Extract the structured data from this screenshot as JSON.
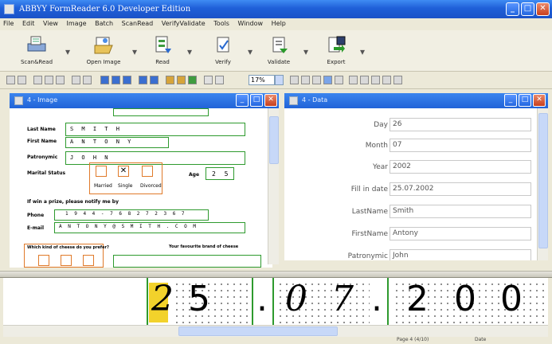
{
  "window": {
    "title": "ABBYY FormReader 6.0 Developer Edition",
    "minimize": "_",
    "maximize": "□",
    "close": "✕"
  },
  "menu": [
    "File",
    "Edit",
    "View",
    "Image",
    "Batch",
    "ScanRead",
    "VerifyValidate",
    "Tools",
    "Window",
    "Help"
  ],
  "toolbar": {
    "scan_read": "Scan&Read",
    "open_image": "Open Image",
    "read": "Read",
    "verify": "Verify",
    "validate": "Validate",
    "export": "Export",
    "zoom": "17%"
  },
  "image_pane": {
    "title": "4 - Image",
    "form": {
      "last_name_label": "Last Name",
      "last_name_value": "S M I T H",
      "first_name_label": "First Name",
      "first_name_value": "A N T O N Y",
      "patronymic_label": "Patronymic",
      "patronymic_value": "J O H N",
      "marital_label": "Marital Status",
      "marital_options": [
        "Married",
        "Single",
        "Divorced"
      ],
      "age_label": "Age",
      "age_value": "2 5",
      "prize_text": "If win a prize, please notify me by",
      "phone_label": "Phone",
      "phone_value": "1 9 4 4 - 7 6 8 2 7 2 3 6 7",
      "email_label": "E-mail",
      "email_value": "A N T O N Y @ S M I T H . C O M",
      "q1": "Which kind of cheese do you prefer?",
      "q2": "Your favourite brand of cheese"
    }
  },
  "data_pane": {
    "title": "4 - Data",
    "fields": [
      {
        "label": "Day",
        "value": "26"
      },
      {
        "label": "Month",
        "value": "07"
      },
      {
        "label": "Year",
        "value": "2002"
      },
      {
        "label": "Fill in date",
        "value": "25.07.2002"
      },
      {
        "label": "LastName",
        "value": "Smith"
      },
      {
        "label": "FirstName",
        "value": "Antony"
      },
      {
        "label": "Patronymic",
        "value": "John"
      }
    ]
  },
  "zoom_view": {
    "chars": [
      "2",
      "5",
      ".",
      "0",
      "7",
      ".",
      "2",
      "0",
      "0"
    ]
  },
  "status": {
    "left": "Page 4 (4/10)",
    "right": "Date"
  }
}
